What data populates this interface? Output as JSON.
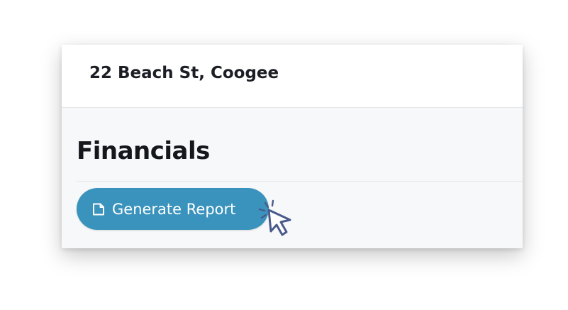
{
  "header": {
    "address": "22 Beach St, Coogee"
  },
  "section": {
    "title": "Financials"
  },
  "actions": {
    "generate_report_label": "Generate Report",
    "generate_report_icon": "document-icon"
  },
  "colors": {
    "button_bg": "#3a93bd",
    "button_text": "#ffffff",
    "cursor_fill": "#4a5a8c"
  }
}
